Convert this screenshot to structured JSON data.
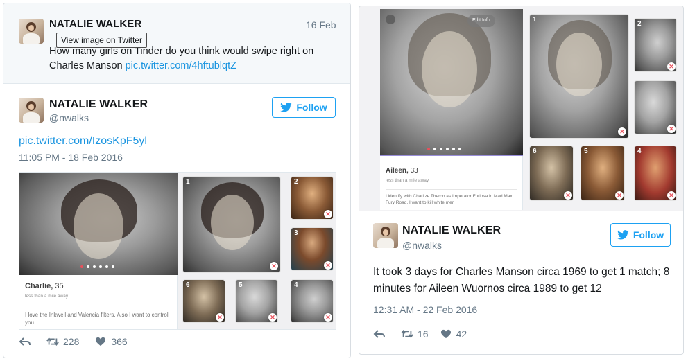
{
  "parent_tweet": {
    "name": "NATALIE WALKER",
    "date": "16 Feb",
    "tooltip": "View image on Twitter",
    "text": "How many girls on Tinder do you think would swipe right on Charles Manson ",
    "link": "pic.twitter.com/4hftublqtZ"
  },
  "tweet1": {
    "name": "NATALIE WALKER",
    "handle": "@nwalks",
    "follow_label": "Follow",
    "pic_link": "pic.twitter.com/IzosKpF5yl",
    "timestamp": "11:05 PM - 18 Feb 2016",
    "card": {
      "name": "Charlie,",
      "age": "35",
      "distance": "less than a mile away",
      "bio": "I love the Inkwell and Valencia filters. Also I want to control you"
    },
    "photo_numbers": [
      "1",
      "2",
      "3",
      "6",
      "5",
      "4"
    ],
    "actions": {
      "reply_icon": "reply-icon",
      "retweet_icon": "retweet-icon",
      "retweets": "228",
      "like_icon": "heart-icon",
      "likes": "366"
    }
  },
  "tweet2": {
    "name": "NATALIE WALKER",
    "handle": "@nwalks",
    "follow_label": "Follow",
    "text": "It took 3 days for Charles Manson circa 1969 to get 1 match; 8 minutes for Aileen Wuornos circa 1989 to get 12",
    "timestamp": "12:31 AM - 22 Feb 2016",
    "card": {
      "edit_info": "Edit Info",
      "name": "Aileen,",
      "age": "33",
      "distance": "less than a mile away",
      "bio": "I identify with Charlize Theron as Imperator Furiosa in Mad Max: Fury Road, I want to kill white men"
    },
    "photo_numbers": [
      "1",
      "2",
      "6",
      "5",
      "4"
    ],
    "actions": {
      "retweets": "16",
      "likes": "42"
    }
  },
  "colors": {
    "twitter_blue": "#1da1f2",
    "link_blue": "#1b95e0",
    "tinder_red": "#e8505b",
    "gray_text": "#657786"
  }
}
